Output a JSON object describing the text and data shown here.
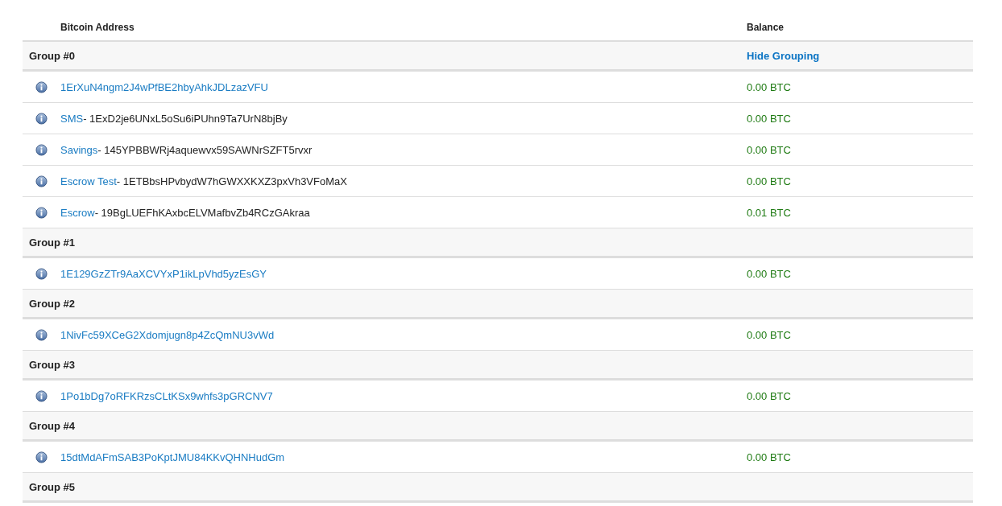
{
  "table": {
    "columns": [
      "Bitcoin Address",
      "Balance"
    ],
    "groups": [
      {
        "title": "Group #0",
        "action": "Hide Grouping",
        "addresses": [
          {
            "address": "1ErXuN4ngm2J4wPfBE2hbyAhkJDLzazVFU",
            "balance": "0.00 BTC"
          },
          {
            "label": "SMS",
            "separator": "-",
            "address": "1ExD2je6UNxL5oSu6iPUhn9Ta7UrN8bjBy",
            "balance": "0.00 BTC"
          },
          {
            "label": "Savings",
            "separator": "-",
            "address": "145YPBBWRj4aquewvx59SAWNrSZFT5rvxr",
            "balance": "0.00 BTC"
          },
          {
            "label": "Escrow Test",
            "separator": "-",
            "address": "1ETBbsHPvbydW7hGWXXKXZ3pxVh3VFoMaX",
            "balance": "0.00 BTC"
          },
          {
            "label": "Escrow",
            "separator": "-",
            "address": "19BgLUEFhKAxbcELVMafbvZb4RCzGAkraa",
            "balance": "0.01 BTC"
          }
        ]
      },
      {
        "title": "Group #1",
        "addresses": [
          {
            "address": "1E129GzZTr9AaXCVYxP1ikLpVhd5yzEsGY",
            "balance": "0.00 BTC"
          }
        ]
      },
      {
        "title": "Group #2",
        "addresses": [
          {
            "address": "1NivFc59XCeG2Xdomjugn8p4ZcQmNU3vWd",
            "balance": "0.00 BTC"
          }
        ]
      },
      {
        "title": "Group #3",
        "addresses": [
          {
            "address": "1Po1bDg7oRFKRzsCLtKSx9whfs3pGRCNV7",
            "balance": "0.00 BTC"
          }
        ]
      },
      {
        "title": "Group #4",
        "addresses": [
          {
            "address": "15dtMdAFmSAB3PoKptJMU84KKvQHNHudGm",
            "balance": "0.00 BTC"
          }
        ]
      },
      {
        "title": "Group #5"
      }
    ]
  }
}
